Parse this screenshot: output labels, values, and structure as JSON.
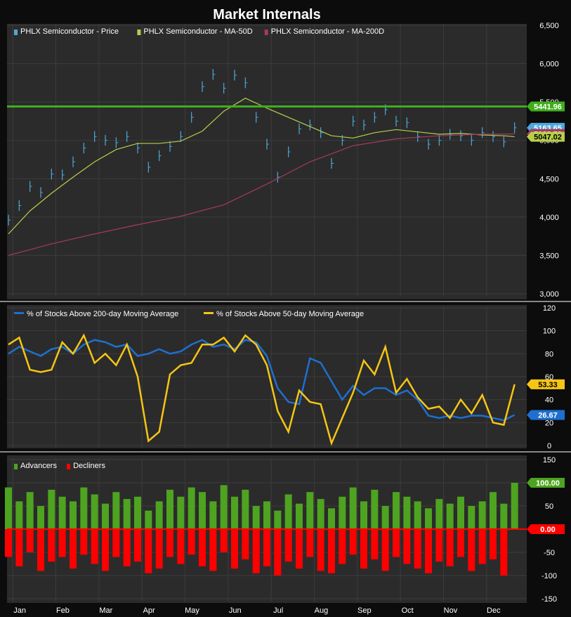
{
  "title": "Market Internals",
  "colors": {
    "background": "#0c0c0c",
    "panel": "#2b2b2b",
    "grid": "#3c3c3c",
    "price": "#4fa8dc",
    "ma50": "#b7cf4a",
    "ma200": "#a8395e",
    "resistance": "#3fae1c",
    "pct200": "#1e6fd0",
    "pct50": "#f6c514",
    "advancers": "#4ea320",
    "decliners": "#ff0000"
  },
  "x_months": [
    "Jan",
    "Feb",
    "Mar",
    "Apr",
    "May",
    "Jun",
    "Jul",
    "Aug",
    "Sep",
    "Oct",
    "Nov",
    "Dec"
  ],
  "chart_data": [
    {
      "type": "line",
      "panel": "price",
      "legend": [
        "PHLX Semiconductor - Price",
        "PHLX Semiconductor - MA-50D",
        "PHLX Semiconductor - MA-200D"
      ],
      "ylim": [
        3000,
        6500
      ],
      "yticks": [
        3000,
        3500,
        4000,
        4500,
        5000,
        5500,
        6000,
        6500
      ],
      "ytick_labels": [
        "3,000",
        "3,500",
        "4,000",
        "4,500",
        "5,000",
        "5,500",
        "6,000",
        "6,500"
      ],
      "horizontal_line": 5441.96,
      "last_labels": [
        {
          "value": 5441.96,
          "text": "5441.96",
          "color": "#3fae1c"
        },
        {
          "value": 5163.65,
          "text": "5163.65",
          "color": "#4fa8dc"
        },
        {
          "value": 5083.59,
          "text": "5083.59",
          "color": "#a8395e"
        },
        {
          "value": 5047.02,
          "text": "5047.02",
          "color": "#b7cf4a"
        }
      ],
      "series": [
        {
          "name": "PHLX Semiconductor - Price",
          "style": "ohlc-bars",
          "x": [
            0,
            0.25,
            0.5,
            0.75,
            1,
            1.25,
            1.5,
            1.75,
            2,
            2.25,
            2.5,
            2.75,
            3,
            3.25,
            3.5,
            3.75,
            4,
            4.25,
            4.5,
            4.75,
            5,
            5.25,
            5.5,
            5.75,
            6,
            6.25,
            6.5,
            6.75,
            7,
            7.25,
            7.5,
            7.75,
            8,
            8.25,
            8.5,
            8.75,
            9,
            9.25,
            9.5,
            9.75,
            10,
            10.25,
            10.5,
            10.75,
            11,
            11.25,
            11.5,
            11.75
          ],
          "values": [
            3960,
            4150,
            4400,
            4320,
            4560,
            4550,
            4720,
            4900,
            5050,
            5000,
            4970,
            5050,
            4900,
            4650,
            4800,
            4920,
            5050,
            5300,
            5700,
            5860,
            5680,
            5850,
            5750,
            5300,
            4950,
            4520,
            4850,
            5150,
            5200,
            5100,
            4700,
            5000,
            5250,
            5200,
            5300,
            5400,
            5250,
            5230,
            5050,
            4950,
            5000,
            5080,
            5060,
            5000,
            5100,
            5050,
            4980,
            5163.65
          ]
        },
        {
          "name": "PHLX Semiconductor - MA-50D",
          "style": "line",
          "x": [
            0,
            0.5,
            1,
            1.5,
            2,
            2.5,
            3,
            3.5,
            4,
            4.5,
            5,
            5.5,
            6,
            6.5,
            7,
            7.5,
            8,
            8.5,
            9,
            9.5,
            10,
            10.5,
            11,
            11.5,
            11.75
          ],
          "values": [
            3780,
            4080,
            4310,
            4520,
            4720,
            4880,
            4960,
            4960,
            4990,
            5120,
            5380,
            5550,
            5420,
            5300,
            5180,
            5060,
            5030,
            5100,
            5140,
            5110,
            5080,
            5090,
            5070,
            5060,
            5047.02
          ]
        },
        {
          "name": "PHLX Semiconductor - MA-200D",
          "style": "line",
          "x": [
            0,
            1,
            2,
            3,
            4,
            5,
            6,
            7,
            8,
            9,
            10,
            11,
            11.75
          ],
          "values": [
            3500,
            3650,
            3780,
            3900,
            4010,
            4160,
            4430,
            4720,
            4930,
            5020,
            5060,
            5080,
            5083.59
          ]
        }
      ]
    },
    {
      "type": "line",
      "panel": "breadth",
      "legend": [
        "% of Stocks Above 200-day Moving Average",
        "% of Stocks Above 50-day Moving Average"
      ],
      "ylim": [
        0,
        120
      ],
      "yticks": [
        0,
        20,
        40,
        60,
        80,
        100,
        120
      ],
      "ytick_labels": [
        "0",
        "20",
        "40",
        "60",
        "80",
        "100",
        "120"
      ],
      "last_labels": [
        {
          "value": 53.33,
          "text": "53.33",
          "color": "#f6c514"
        },
        {
          "value": 26.67,
          "text": "26.67",
          "color": "#1e6fd0"
        }
      ],
      "series": [
        {
          "name": "% of Stocks Above 200-day Moving Average",
          "x": [
            0,
            0.25,
            0.5,
            0.75,
            1,
            1.25,
            1.5,
            1.75,
            2,
            2.25,
            2.5,
            2.75,
            3,
            3.25,
            3.5,
            3.75,
            4,
            4.25,
            4.5,
            4.75,
            5,
            5.25,
            5.5,
            5.75,
            6,
            6.25,
            6.5,
            6.75,
            7,
            7.25,
            7.5,
            7.75,
            8,
            8.25,
            8.5,
            8.75,
            9,
            9.25,
            9.5,
            9.75,
            10,
            10.25,
            10.5,
            10.75,
            11,
            11.25,
            11.5,
            11.75
          ],
          "values": [
            80,
            86,
            82,
            78,
            84,
            86,
            80,
            88,
            92,
            90,
            86,
            88,
            78,
            80,
            84,
            80,
            82,
            88,
            92,
            86,
            88,
            84,
            92,
            90,
            78,
            50,
            38,
            36,
            76,
            72,
            56,
            40,
            52,
            44,
            50,
            50,
            44,
            48,
            40,
            26,
            24,
            26,
            24,
            26,
            26,
            24,
            22,
            26.67
          ]
        },
        {
          "name": "% of Stocks Above 50-day Moving Average",
          "x": [
            0,
            0.25,
            0.5,
            0.75,
            1,
            1.25,
            1.5,
            1.75,
            2,
            2.25,
            2.5,
            2.75,
            3,
            3.25,
            3.5,
            3.75,
            4,
            4.25,
            4.5,
            4.75,
            5,
            5.25,
            5.5,
            5.75,
            6,
            6.25,
            6.5,
            6.75,
            7,
            7.25,
            7.5,
            7.75,
            8,
            8.25,
            8.5,
            8.75,
            9,
            9.25,
            9.5,
            9.75,
            10,
            10.25,
            10.5,
            10.75,
            11,
            11.25,
            11.5,
            11.75
          ],
          "values": [
            88,
            94,
            66,
            64,
            66,
            90,
            80,
            96,
            72,
            80,
            70,
            88,
            60,
            4,
            12,
            62,
            70,
            72,
            88,
            88,
            94,
            82,
            96,
            88,
            70,
            30,
            12,
            48,
            38,
            36,
            2,
            24,
            46,
            74,
            62,
            86,
            46,
            58,
            42,
            32,
            34,
            24,
            40,
            28,
            44,
            20,
            18,
            53.33
          ]
        }
      ]
    },
    {
      "type": "bar",
      "panel": "advance-decline",
      "legend": [
        "Advancers",
        "Decliners"
      ],
      "ylim": [
        -150,
        150
      ],
      "yticks": [
        -150,
        -100,
        -50,
        0,
        50,
        100,
        150
      ],
      "ytick_labels": [
        "-150",
        "-100",
        "-50",
        "0",
        "50",
        "100",
        "150"
      ],
      "last_labels": [
        {
          "value": 100.0,
          "text": "100.00",
          "color": "#4ea320"
        },
        {
          "value": 0.0,
          "text": "0.00",
          "color": "#ff0000"
        }
      ],
      "series": [
        {
          "name": "Advancers",
          "x": [
            0,
            0.25,
            0.5,
            0.75,
            1,
            1.25,
            1.5,
            1.75,
            2,
            2.25,
            2.5,
            2.75,
            3,
            3.25,
            3.5,
            3.75,
            4,
            4.25,
            4.5,
            4.75,
            5,
            5.25,
            5.5,
            5.75,
            6,
            6.25,
            6.5,
            6.75,
            7,
            7.25,
            7.5,
            7.75,
            8,
            8.25,
            8.5,
            8.75,
            9,
            9.25,
            9.5,
            9.75,
            10,
            10.25,
            10.5,
            10.75,
            11,
            11.25,
            11.5,
            11.75
          ],
          "values": [
            90,
            60,
            80,
            50,
            85,
            70,
            60,
            90,
            75,
            55,
            80,
            65,
            70,
            40,
            60,
            85,
            70,
            90,
            80,
            60,
            95,
            70,
            85,
            50,
            60,
            40,
            75,
            55,
            80,
            65,
            45,
            70,
            90,
            60,
            85,
            50,
            80,
            70,
            60,
            45,
            65,
            55,
            70,
            50,
            60,
            80,
            55,
            100
          ]
        },
        {
          "name": "Decliners",
          "x": [
            0,
            0.25,
            0.5,
            0.75,
            1,
            1.25,
            1.5,
            1.75,
            2,
            2.25,
            2.5,
            2.75,
            3,
            3.25,
            3.5,
            3.75,
            4,
            4.25,
            4.5,
            4.75,
            5,
            5.25,
            5.5,
            5.75,
            6,
            6.25,
            6.5,
            6.75,
            7,
            7.25,
            7.5,
            7.75,
            8,
            8.25,
            8.5,
            8.75,
            9,
            9.25,
            9.5,
            9.75,
            10,
            10.25,
            10.5,
            10.75,
            11,
            11.25,
            11.5,
            11.75
          ],
          "values": [
            -60,
            -80,
            -50,
            -90,
            -70,
            -60,
            -85,
            -55,
            -75,
            -90,
            -60,
            -80,
            -70,
            -95,
            -85,
            -60,
            -75,
            -55,
            -80,
            -90,
            -50,
            -85,
            -65,
            -95,
            -80,
            -100,
            -70,
            -85,
            -60,
            -90,
            -95,
            -75,
            -55,
            -85,
            -65,
            -90,
            -60,
            -75,
            -85,
            -95,
            -70,
            -80,
            -60,
            -90,
            -75,
            -65,
            -100,
            0
          ]
        }
      ]
    }
  ]
}
